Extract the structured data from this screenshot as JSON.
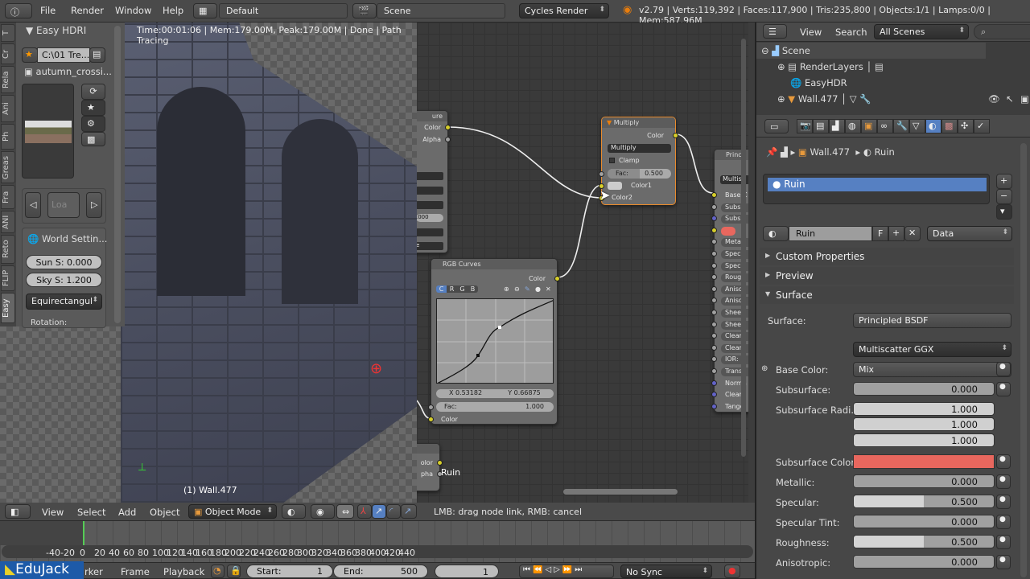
{
  "topbar": {
    "menus": [
      "File",
      "Render",
      "Window",
      "Help"
    ],
    "layout": "Default",
    "scene": "Scene",
    "engine": "Cycles Render",
    "stats": "v2.79 | Verts:119,392 | Faces:117,900 | Tris:235,800 | Objects:1/1 | Lamps:0/0 | Mem:587.96M"
  },
  "toolshelf": {
    "tabs": [
      "T",
      "Cr",
      "Rela",
      "Ani",
      "Ph",
      "Greas",
      "Fra",
      "ANI",
      "Reto",
      "FLIP",
      "Easy"
    ],
    "panel_title": "Easy HDRI",
    "path": "C:\\01 Tre...",
    "hdri_name": "autumn_crossi...",
    "load_label": "Loa",
    "world_settings": "World Settin...",
    "sun": "Sun S: 0.000",
    "sky": "Sky S: 1.200",
    "projection": "Equirectangul",
    "rotation": "Rotation:"
  },
  "viewport": {
    "status": "Time:00:01:06 | Mem:179.00M, Peak:179.00M | Done | Path Tracing",
    "object_label": "(1) Wall.477"
  },
  "viewport_header": {
    "menus": [
      "View",
      "Select",
      "Add",
      "Object"
    ],
    "mode": "Object Mode"
  },
  "node_editor": {
    "hint": "LMB: drag node link, RMB: cancel",
    "image_node": {
      "title": "ure",
      "outputs": [
        "Color",
        "Alpha"
      ],
      "value": ".000",
      "last": "e"
    },
    "multiply": {
      "title": "Multiply",
      "output": "Color",
      "blend": "Multiply",
      "clamp": "Clamp",
      "fac_label": "Fac:",
      "fac": "0.500",
      "inputs": [
        "Color1",
        "Color2"
      ]
    },
    "curves": {
      "title": "RGB Curves",
      "output": "Color",
      "channels": [
        "C",
        "R",
        "G",
        "B"
      ],
      "x": "X 0.53182",
      "y": "Y 0.66875",
      "fac_label": "Fac:",
      "fac": "1.000",
      "input": "Color"
    },
    "principled": {
      "title": "Princi",
      "dist": "Multis",
      "sockets": [
        "Base C",
        "Subs",
        "Subsu",
        "",
        "Metal",
        "Spec",
        "Spec",
        "Roug",
        "Aniso",
        "Aniso",
        "Shee",
        "Shee",
        "Clear",
        "Clear",
        "IOR:",
        "Trans",
        "Norma",
        "Clearc",
        "Tange"
      ]
    },
    "bottom_node": {
      "outputs": [
        "olor",
        "pha"
      ],
      "label": "Ruin"
    }
  },
  "outliner": {
    "menus": [
      "View",
      "Search"
    ],
    "filter": "All Scenes",
    "items": [
      "Scene",
      "RenderLayers",
      "EasyHDR",
      "Wall.477"
    ]
  },
  "properties": {
    "breadcrumb": [
      "Wall.477",
      "Ruin"
    ],
    "slot": "Ruin",
    "material": "Ruin",
    "fake": "F",
    "link": "Data",
    "panels": [
      "Custom Properties",
      "Preview",
      "Surface"
    ],
    "surface_label": "Surface:",
    "surface": "Principled BSDF",
    "distribution": "Multiscatter GGX",
    "rows": [
      {
        "label": "Base Color:",
        "value": "Mix"
      },
      {
        "label": "Subsurface:",
        "value": "0.000",
        "fill": 0
      },
      {
        "label": "Subsurface Radi...",
        "value": "1.000"
      },
      {
        "label": "",
        "value": "1.000"
      },
      {
        "label": "",
        "value": "1.000"
      },
      {
        "label": "Subsurface Color:",
        "color": "#e8675e"
      },
      {
        "label": "Metallic:",
        "value": "0.000",
        "fill": 0
      },
      {
        "label": "Specular:",
        "value": "0.500",
        "fill": 0.5
      },
      {
        "label": "Specular Tint:",
        "value": "0.000",
        "fill": 0
      },
      {
        "label": "Roughness:",
        "value": "0.500",
        "fill": 0.5
      },
      {
        "label": "Anisotropic:",
        "value": "0.000",
        "fill": 0
      }
    ]
  },
  "timeline": {
    "ticks": [
      "-40",
      "-20",
      "0",
      "20",
      "40",
      "60",
      "80",
      "100",
      "120",
      "140",
      "160",
      "180",
      "200",
      "220",
      "240",
      "260",
      "280",
      "300",
      "320",
      "340",
      "360",
      "380",
      "400",
      "420",
      "440"
    ],
    "menus": [
      "arker",
      "Frame",
      "Playback"
    ],
    "start_label": "Start:",
    "start": "1",
    "end_label": "End:",
    "end": "500",
    "current": "1",
    "sync": "No Sync",
    "current_frame": 0
  },
  "watermark": "EduJack"
}
